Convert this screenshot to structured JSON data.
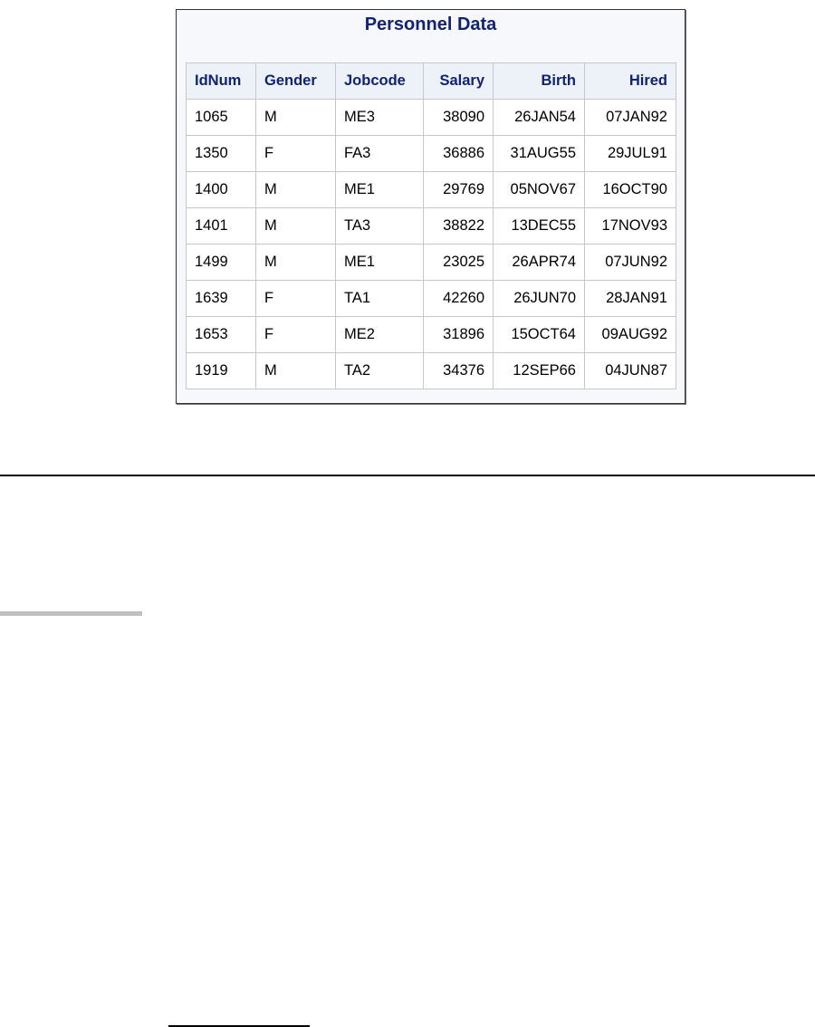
{
  "table": {
    "title": "Personnel Data",
    "headers": [
      "IdNum",
      "Gender",
      "Jobcode",
      "Salary",
      "Birth",
      "Hired"
    ],
    "rows": [
      [
        "1065",
        "M",
        "ME3",
        "38090",
        "26JAN54",
        "07JAN92"
      ],
      [
        "1350",
        "F",
        "FA3",
        "36886",
        "31AUG55",
        "29JUL91"
      ],
      [
        "1400",
        "M",
        "ME1",
        "29769",
        "05NOV67",
        "16OCT90"
      ],
      [
        "1401",
        "M",
        "TA3",
        "38822",
        "13DEC55",
        "17NOV93"
      ],
      [
        "1499",
        "M",
        "ME1",
        "23025",
        "26APR74",
        "07JUN92"
      ],
      [
        "1639",
        "F",
        "TA1",
        "42260",
        "26JUN70",
        "28JAN91"
      ],
      [
        "1653",
        "F",
        "ME2",
        "31896",
        "15OCT64",
        "09AUG92"
      ],
      [
        "1919",
        "M",
        "TA2",
        "34376",
        "12SEP66",
        "04JUN87"
      ]
    ]
  }
}
